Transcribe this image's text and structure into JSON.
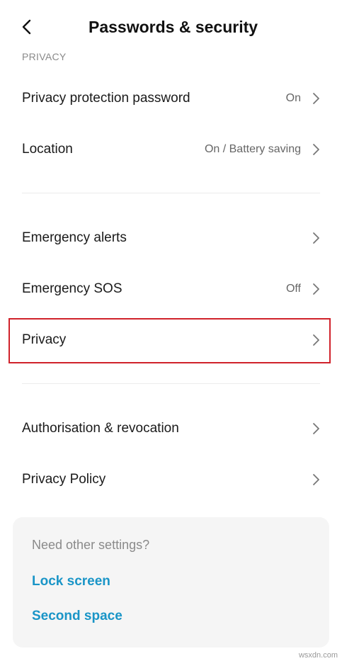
{
  "header": {
    "title": "Passwords & security",
    "back_icon": "chevron-left-icon"
  },
  "section": {
    "label": "PRIVACY"
  },
  "rows": [
    {
      "label": "Privacy protection password",
      "value": "On"
    },
    {
      "label": "Location",
      "value": "On / Battery saving"
    },
    {
      "label": "Emergency alerts",
      "value": ""
    },
    {
      "label": "Emergency SOS",
      "value": "Off"
    },
    {
      "label": "Privacy",
      "value": ""
    },
    {
      "label": "Authorisation & revocation",
      "value": ""
    },
    {
      "label": "Privacy Policy",
      "value": ""
    }
  ],
  "card": {
    "hint": "Need other settings?",
    "links": [
      "Lock screen",
      "Second space"
    ]
  },
  "watermark": "wsxdn.com",
  "colors": {
    "highlight": "#d0222b",
    "link": "#1a95c7",
    "secondary_text": "#8a8a8a"
  }
}
